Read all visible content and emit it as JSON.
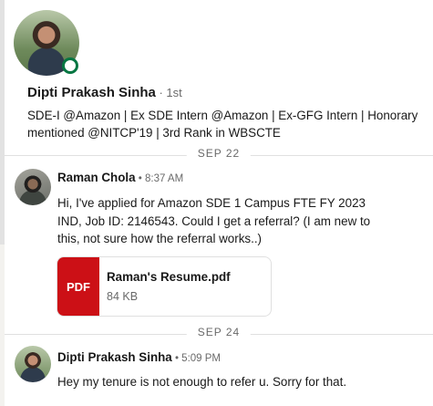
{
  "profile": {
    "name": "Dipti Prakash Sinha",
    "degree": " · 1st",
    "headline": "SDE-I @Amazon | Ex SDE Intern @Amazon | Ex-GFG Intern | Honorary mentioned @NITCP'19 | 3rd Rank in WBSCTE",
    "presence_color": "#057642"
  },
  "dividers": [
    "SEP 22",
    "SEP 24"
  ],
  "messages": [
    {
      "sender": "Raman Chola",
      "time": " • 8:37 AM",
      "text": "Hi, I've applied for Amazon SDE 1 Campus FTE FY 2023 IND, Job ID: 2146543. Could I get a referral? (I am new to this, not sure how the referral works..)",
      "attachment": {
        "badge": "PDF",
        "file_name": "Raman's Resume.pdf",
        "file_size": "84 KB"
      }
    },
    {
      "sender": "Dipti Prakash Sinha",
      "time": " • 5:09 PM",
      "text": "Hey my tenure is not enough to refer u. Sorry for that."
    }
  ],
  "colors": {
    "pdf_red": "#cc1016",
    "divider": "#e0e0e0"
  }
}
